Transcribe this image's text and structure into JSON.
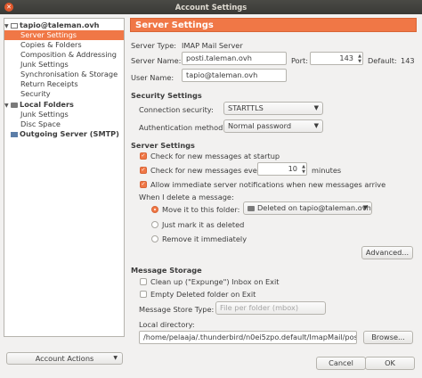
{
  "window": {
    "title": "Account Settings"
  },
  "sidebar": {
    "items": [
      {
        "label": "tapio@taleman.ovh",
        "bold": true
      },
      {
        "label": "Server Settings",
        "selected": true
      },
      {
        "label": "Copies & Folders"
      },
      {
        "label": "Composition & Addressing"
      },
      {
        "label": "Junk Settings"
      },
      {
        "label": "Synchronisation & Storage"
      },
      {
        "label": "Return Receipts"
      },
      {
        "label": "Security"
      },
      {
        "label": "Local Folders",
        "bold": true
      },
      {
        "label": "Junk Settings"
      },
      {
        "label": "Disc Space"
      },
      {
        "label": "Outgoing Server (SMTP)",
        "bold": true
      }
    ],
    "account_actions": "Account Actions"
  },
  "main": {
    "header": "Server Settings",
    "server_type_label": "Server Type:",
    "server_type_value": "IMAP Mail Server",
    "server_name_label": "Server Name:",
    "server_name_value": "posti.taleman.ovh",
    "port_label": "Port:",
    "port_value": "143",
    "default_label": "Default:",
    "default_value": "143",
    "user_name_label": "User Name:",
    "user_name_value": "tapio@taleman.ovh",
    "security_settings_title": "Security Settings",
    "connection_security_label": "Connection security:",
    "connection_security_value": "STARTTLS",
    "auth_method_label": "Authentication method:",
    "auth_method_value": "Normal password",
    "server_settings_title": "Server Settings",
    "check_startup_label": "Check for new messages at startup",
    "check_every_label": "Check for new messages every",
    "check_every_value": "10",
    "minutes_label": "minutes",
    "allow_immediate_label": "Allow immediate server notifications when new messages arrive",
    "when_delete_label": "When I delete a message:",
    "move_folder_label": "Move it to this folder:",
    "move_folder_value": "Deleted on tapio@taleman.ovh",
    "just_mark_label": "Just mark it as deleted",
    "remove_immediately_label": "Remove it immediately",
    "advanced_button": "Advanced...",
    "message_storage_title": "Message Storage",
    "clean_up_label": "Clean up (\"Expunge\") Inbox on Exit",
    "empty_deleted_label": "Empty Deleted folder on Exit",
    "store_type_label": "Message Store Type:",
    "store_type_value": "File per folder (mbox)",
    "local_dir_label": "Local directory:",
    "local_dir_value": "/home/pelaaja/.thunderbird/n0ei5zpo.default/ImapMail/posti",
    "browse_button": "Browse..."
  },
  "footer": {
    "cancel": "Cancel",
    "ok": "OK"
  },
  "colors": {
    "accent": "#f07746",
    "titlebar": "#3c3b37"
  }
}
